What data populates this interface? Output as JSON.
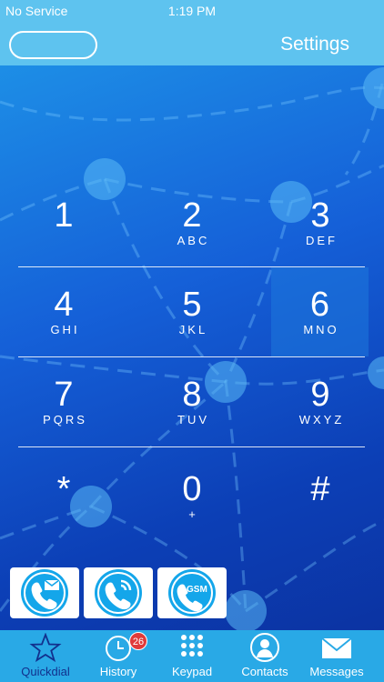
{
  "status_bar": {
    "carrier": "No Service",
    "time": "1:19 PM"
  },
  "nav_bar": {
    "settings_label": "Settings"
  },
  "keypad": {
    "keys": [
      {
        "digit": "1",
        "letters": ""
      },
      {
        "digit": "2",
        "letters": "ABC"
      },
      {
        "digit": "3",
        "letters": "DEF"
      },
      {
        "digit": "4",
        "letters": "GHI"
      },
      {
        "digit": "5",
        "letters": "JKL"
      },
      {
        "digit": "6",
        "letters": "MNO"
      },
      {
        "digit": "7",
        "letters": "PQRS"
      },
      {
        "digit": "8",
        "letters": "TUV"
      },
      {
        "digit": "9",
        "letters": "WXYZ"
      },
      {
        "digit": "*",
        "letters": ""
      },
      {
        "digit": "0",
        "letters": "+"
      },
      {
        "digit": "#",
        "letters": ""
      }
    ]
  },
  "call_buttons": [
    {
      "icon": "phone-message-icon"
    },
    {
      "icon": "phone-ringing-icon"
    },
    {
      "icon": "phone-gsm-icon",
      "label": "GSM"
    }
  ],
  "tabs": [
    {
      "label": "Quickdial",
      "icon": "star-icon",
      "active": true
    },
    {
      "label": "History",
      "icon": "clock-icon",
      "badge": "26"
    },
    {
      "label": "Keypad",
      "icon": "keypad-grid-icon"
    },
    {
      "label": "Contacts",
      "icon": "person-icon"
    },
    {
      "label": "Messages",
      "icon": "envelope-icon"
    }
  ],
  "colors": {
    "bar": "#5ec3ef",
    "tab_bar": "#29a9e6",
    "active_tab": "#12308d",
    "badge": "#e03a3a"
  }
}
